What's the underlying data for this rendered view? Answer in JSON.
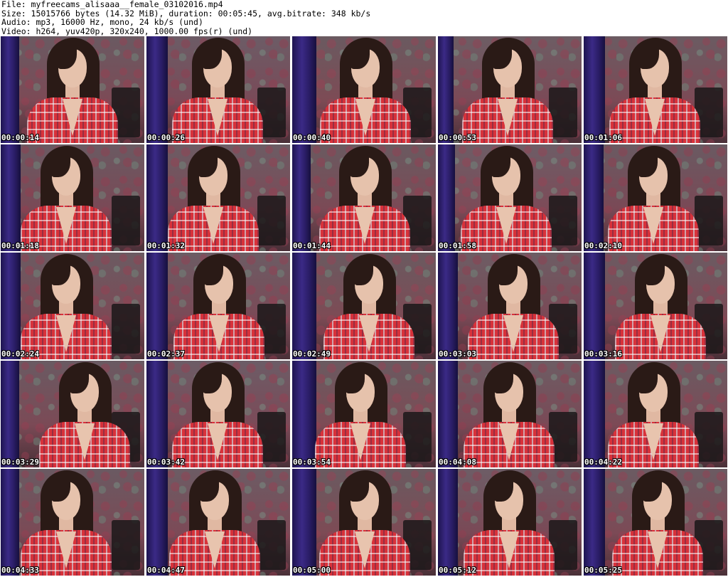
{
  "header": {
    "file_line": "File: myfreecams_alisaaa__female_03102016.mp4",
    "size_line": "Size: 15015766 bytes (14.32 MiB), duration: 00:05:45, avg.bitrate: 348 kb/s",
    "audio_line": "Audio: mp3, 16000 Hz, mono, 24 kb/s (und)",
    "video_line": "Video: h264, yuv420p, 320x240, 1000.00 fps(r) (und)"
  },
  "frames": [
    {
      "timestamp": "00:00:14"
    },
    {
      "timestamp": "00:00:26"
    },
    {
      "timestamp": "00:00:40"
    },
    {
      "timestamp": "00:00:53"
    },
    {
      "timestamp": "00:01:06"
    },
    {
      "timestamp": "00:01:18"
    },
    {
      "timestamp": "00:01:32"
    },
    {
      "timestamp": "00:01:44"
    },
    {
      "timestamp": "00:01:58"
    },
    {
      "timestamp": "00:02:10"
    },
    {
      "timestamp": "00:02:24"
    },
    {
      "timestamp": "00:02:37"
    },
    {
      "timestamp": "00:02:49"
    },
    {
      "timestamp": "00:03:03"
    },
    {
      "timestamp": "00:03:16"
    },
    {
      "timestamp": "00:03:29"
    },
    {
      "timestamp": "00:03:42"
    },
    {
      "timestamp": "00:03:54"
    },
    {
      "timestamp": "00:04:08"
    },
    {
      "timestamp": "00:04:22"
    },
    {
      "timestamp": "00:04:33"
    },
    {
      "timestamp": "00:04:47"
    },
    {
      "timestamp": "00:05:00"
    },
    {
      "timestamp": "00:05:12"
    },
    {
      "timestamp": "00:05:25"
    }
  ],
  "colors": {
    "shirt_red": "#d8323a",
    "curtain_purple": "#3b2a86",
    "hair_dark": "#2a1a16",
    "wallpaper_green": "#6f8f80",
    "wallpaper_red": "#8a3a48"
  }
}
